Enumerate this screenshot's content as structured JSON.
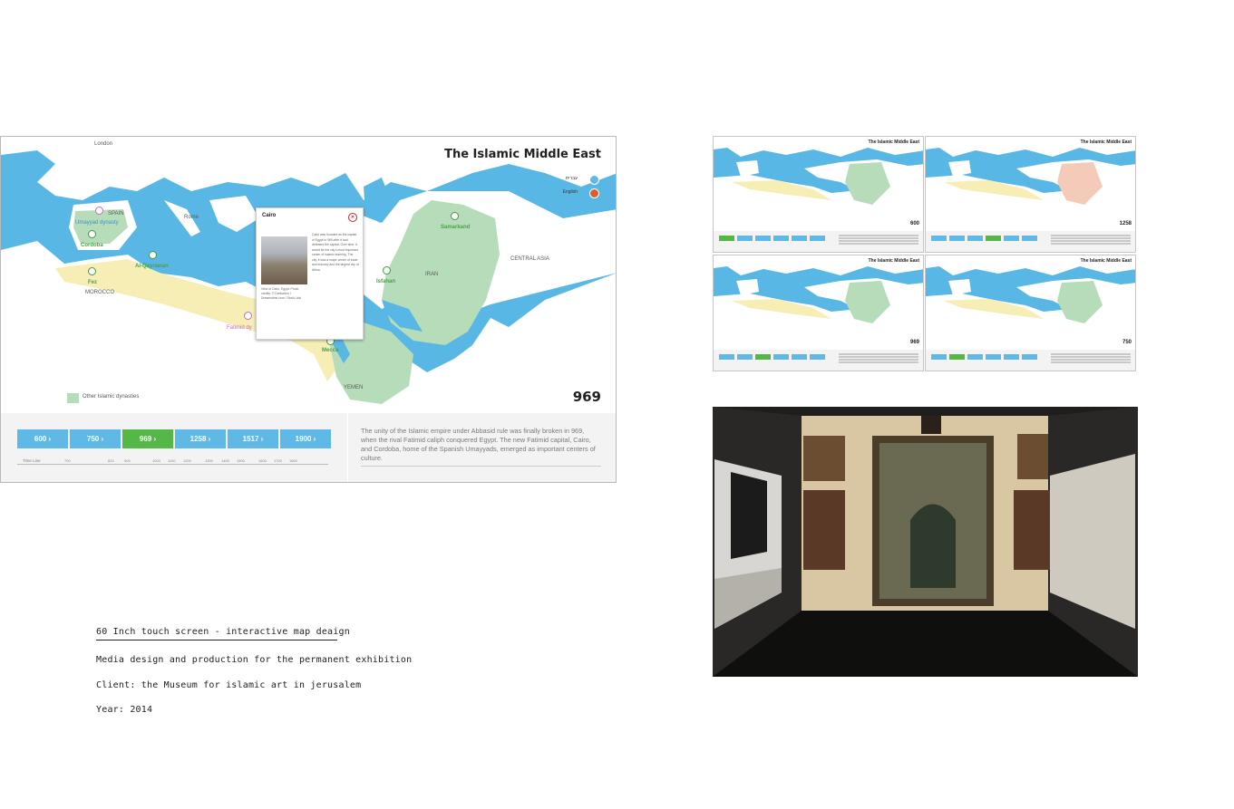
{
  "main_screen": {
    "title": "The Islamic Middle East",
    "current_year": "969",
    "map_labels": {
      "london": "London",
      "spain": "SPAIN",
      "umayyad": "Umayyad dynasty",
      "cordoba": "Cordoba",
      "rome": "Rome",
      "fez": "Fez",
      "morocco": "MOROCCO",
      "al_qayrawan": "Al-Qayrawan",
      "fatimid": "Fatimid dy",
      "mecca": "Mecca",
      "yemen": "YEMEN",
      "iran": "IRAN",
      "isfahan": "Isfahan",
      "samarkand": "Samarkand",
      "central_asia": "CENTRAL ASIA"
    },
    "legend": {
      "item1": "עברית",
      "item2": "English",
      "other_dynasties": "Other Islamic dynasties"
    },
    "popup": {
      "title": "Cairo",
      "close_icon": "close-icon",
      "text": "Cairo was founded as the capital of Egypt in 969 after it had defeated the capital. Over time, it would be the city's most important center of Islamic learning. The city, it was a major center of trade and industry and the largest city of Africa.",
      "caption": "View of Cairo, Egypt. Photo credits: © Dantonbor / Dreamstime.com / Stock Link."
    },
    "timeline": {
      "buttons": [
        {
          "label": "600 ›"
        },
        {
          "label": "750 ›"
        },
        {
          "label": "969 ›"
        },
        {
          "label": "1258 ›"
        },
        {
          "label": "1517 ›"
        },
        {
          "label": "1900 ›"
        }
      ],
      "active_index": 2,
      "label": "Time Line",
      "ticks": [
        "700",
        "820",
        "900",
        "1000",
        "1100",
        "1200",
        "1300",
        "1400",
        "1500",
        "1600",
        "1700",
        "1800"
      ]
    },
    "description": "The unity of the Islamic empire under Abbasid rule was finally broken in 969, when the rival Fatimid caliph conquered Egypt. The new Fatimid capital, Cairo, and Cordoba, home of the Spanish Umayyads, emerged as important centers of culture."
  },
  "thumbnails": [
    {
      "title": "The Islamic Middle East",
      "year": "600",
      "active_index": 0
    },
    {
      "title": "The Islamic Middle East",
      "year": "1258",
      "active_index": 3
    },
    {
      "title": "The Islamic Middle East",
      "year": "969",
      "active_index": 2
    },
    {
      "title": "The Islamic Middle East",
      "year": "750",
      "active_index": 1
    }
  ],
  "caption": {
    "heading": "60 Inch touch screen - interactive map deaign",
    "line1": "Media design and production for the permanent exhibition",
    "line2": "Client: the Museum for islamic art in jerusalem",
    "line3": "Year: 2014"
  },
  "colors": {
    "sea": "#58b7e4",
    "land": "#ffffff",
    "fatimid_territory": "#f7eeb6",
    "other_dynasties": "#b7dcba",
    "active_year": "#54b847",
    "year_button": "#5fb9e6"
  }
}
